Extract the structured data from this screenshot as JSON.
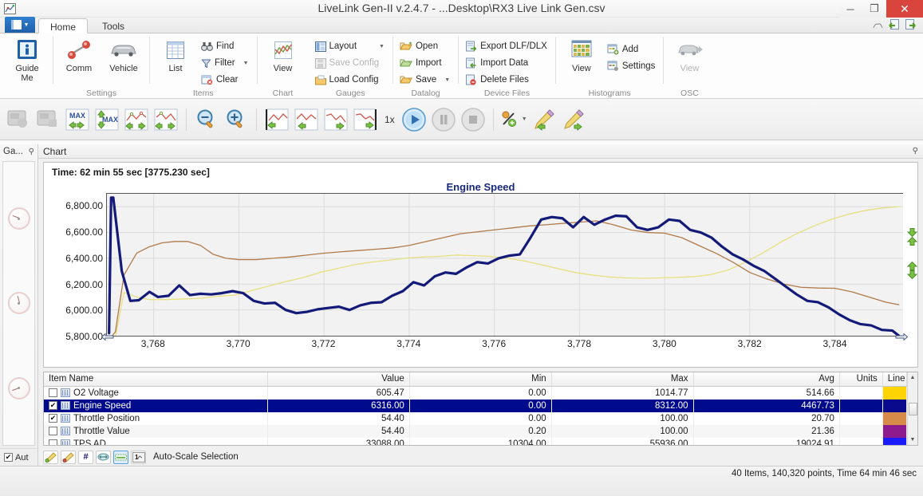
{
  "window": {
    "title": "LiveLink Gen-II  v.2.4.7 - ...Desktop\\RX3 Live Link Gen.csv",
    "app_icon": "chart-app-icon",
    "minimize": "─",
    "maximize": "❐",
    "close": "✕"
  },
  "tabs": {
    "app_menu": "app-menu-button",
    "items": [
      {
        "label": "Home",
        "active": true
      },
      {
        "label": "Tools",
        "active": false
      }
    ],
    "right_icons": [
      "help-cloud-icon",
      "import-page-icon",
      "export-page-icon"
    ]
  },
  "ribbon": {
    "groups": [
      {
        "label": "",
        "big_buttons": [
          {
            "label": "Guide\nMe",
            "icon": "guide-info-icon",
            "disabled": false
          }
        ],
        "small_buttons": []
      },
      {
        "label": "Settings",
        "big_buttons": [
          {
            "label": "Comm",
            "icon": "comm-plug-icon",
            "disabled": false
          },
          {
            "label": "Vehicle",
            "icon": "vehicle-car-icon",
            "disabled": false
          }
        ],
        "small_buttons": []
      },
      {
        "label": "Items",
        "big_buttons": [
          {
            "label": "List",
            "icon": "list-grid-icon",
            "disabled": false
          }
        ],
        "small_buttons": [
          {
            "label": "Find",
            "icon": "find-binoculars-icon",
            "disabled": false,
            "caret": false
          },
          {
            "label": "Filter",
            "icon": "filter-funnel-icon",
            "disabled": false,
            "caret": true
          },
          {
            "label": "Clear",
            "icon": "clear-table-icon",
            "disabled": false,
            "caret": false
          }
        ]
      },
      {
        "label": "Chart",
        "big_buttons": [
          {
            "label": "View",
            "icon": "chart-view-icon",
            "disabled": false
          }
        ],
        "small_buttons": []
      },
      {
        "label": "Gauges",
        "big_buttons": [],
        "small_buttons": [
          {
            "label": "Layout",
            "icon": "layout-icon",
            "disabled": false,
            "caret": true
          },
          {
            "label": "Save Config",
            "icon": "save-config-icon",
            "disabled": true,
            "caret": false
          },
          {
            "label": "Load Config",
            "icon": "load-config-icon",
            "disabled": false,
            "caret": false
          }
        ]
      },
      {
        "label": "Datalog",
        "big_buttons": [],
        "small_buttons": [
          {
            "label": "Open",
            "icon": "open-folder-icon",
            "disabled": false,
            "caret": false
          },
          {
            "label": "Import",
            "icon": "import-icon",
            "disabled": false,
            "caret": false
          },
          {
            "label": "Save",
            "icon": "save-icon",
            "disabled": false,
            "caret": true
          }
        ]
      },
      {
        "label": "Device Files",
        "big_buttons": [],
        "small_buttons": [
          {
            "label": "Export DLF/DLX",
            "icon": "export-file-icon",
            "disabled": false,
            "caret": false
          },
          {
            "label": "Import Data",
            "icon": "import-data-icon",
            "disabled": false,
            "caret": false
          },
          {
            "label": "Delete Files",
            "icon": "delete-file-icon",
            "disabled": false,
            "caret": false
          }
        ]
      },
      {
        "label": "Histograms",
        "big_buttons": [
          {
            "label": "View",
            "icon": "histogram-view-icon",
            "disabled": false
          }
        ],
        "small_buttons": [
          {
            "label": "Add",
            "icon": "add-histogram-icon",
            "disabled": false,
            "caret": false
          },
          {
            "label": "Settings",
            "icon": "histogram-settings-icon",
            "disabled": false,
            "caret": false
          }
        ]
      },
      {
        "label": "OSC",
        "big_buttons": [
          {
            "label": "View",
            "icon": "osc-view-icon",
            "disabled": true
          }
        ],
        "small_buttons": []
      }
    ]
  },
  "toolbar": {
    "speed_label": "1x",
    "buttons": [
      {
        "name": "record-button",
        "icon": "record-disabled-icon",
        "disabled": true
      },
      {
        "name": "stop-record-button",
        "icon": "stop-record-disabled-icon",
        "disabled": true
      },
      {
        "name": "max-prev-button",
        "icon": "max-left-right-icon",
        "disabled": false
      },
      {
        "name": "max-updown-button",
        "icon": "max-up-down-icon",
        "disabled": false
      },
      {
        "name": "trace-prev-button",
        "icon": "trace-left-right-icon",
        "disabled": false
      },
      {
        "name": "trace-next-button",
        "icon": "trace-right-left-icon",
        "disabled": false
      },
      {
        "name": "zoom-out-button",
        "icon": "zoom-out-icon",
        "disabled": false
      },
      {
        "name": "zoom-in-button",
        "icon": "zoom-in-icon",
        "disabled": false
      },
      {
        "name": "marker-start-button",
        "icon": "marker-start-icon",
        "disabled": false
      },
      {
        "name": "marker-left-button",
        "icon": "marker-left-icon",
        "disabled": false
      },
      {
        "name": "marker-right-button",
        "icon": "marker-right-icon",
        "disabled": false
      },
      {
        "name": "marker-end-button",
        "icon": "marker-end-icon",
        "disabled": false
      },
      {
        "name": "play-button",
        "icon": "play-icon",
        "disabled": false
      },
      {
        "name": "pause-button",
        "icon": "pause-icon",
        "disabled": true
      },
      {
        "name": "stop-button",
        "icon": "stop-icon",
        "disabled": true
      },
      {
        "name": "percent-button",
        "icon": "percent-icon",
        "disabled": false,
        "caret": true
      },
      {
        "name": "pencil-left-button",
        "icon": "pencil-left-icon",
        "disabled": false
      },
      {
        "name": "pencil-right-button",
        "icon": "pencil-right-icon",
        "disabled": false
      }
    ]
  },
  "gauges_panel": {
    "title": "Ga...",
    "pin_icon": "pin-icon",
    "auto_checkbox_label": "Aut",
    "auto_checked": true,
    "gauges": [
      "gauge-1",
      "gauge-2",
      "gauge-3"
    ]
  },
  "chart_panel": {
    "header": "Chart",
    "pin_icon": "pin-icon",
    "time_label": "Time: 62 min 55 sec [3775.230 sec]"
  },
  "chart_data": {
    "type": "line",
    "title": "Engine Speed",
    "xlabel": "",
    "ylabel": "",
    "grid": true,
    "legend_position": "none",
    "xlim": [
      3766.9,
      3785.6
    ],
    "ylim": [
      5800,
      6900
    ],
    "yticks": [
      "6,800.00",
      "6,600.00",
      "6,400.00",
      "6,200.00",
      "6,000.00",
      "5,800.00"
    ],
    "ytick_values": [
      6800,
      6600,
      6400,
      6200,
      6000,
      5800
    ],
    "xticks": [
      "3,768",
      "3,770",
      "3,772",
      "3,774",
      "3,776",
      "3,778",
      "3,780",
      "3,782",
      "3,784"
    ],
    "xtick_values": [
      3768,
      3770,
      3772,
      3774,
      3776,
      3778,
      3780,
      3782,
      3784
    ],
    "series": [
      {
        "name": "Engine Speed",
        "color": "#131a78",
        "width": 3.2,
        "x": [
          3766.95,
          3767.0,
          3767.05,
          3767.25,
          3767.45,
          3767.65,
          3767.9,
          3768.1,
          3768.35,
          3768.6,
          3768.85,
          3769.1,
          3769.35,
          3769.6,
          3769.85,
          3770.1,
          3770.35,
          3770.6,
          3770.85,
          3771.1,
          3771.35,
          3771.6,
          3771.85,
          3772.1,
          3772.35,
          3772.6,
          3772.85,
          3773.1,
          3773.35,
          3773.6,
          3773.85,
          3774.1,
          3774.35,
          3774.6,
          3774.85,
          3775.1,
          3775.35,
          3775.6,
          3775.85,
          3776.1,
          3776.35,
          3776.6,
          3776.85,
          3777.1,
          3777.35,
          3777.6,
          3777.85,
          3778.1,
          3778.35,
          3778.6,
          3778.85,
          3779.1,
          3779.35,
          3779.6,
          3779.85,
          3780.1,
          3780.35,
          3780.6,
          3780.85,
          3781.1,
          3781.35,
          3781.6,
          3781.85,
          3782.1,
          3782.35,
          3782.6,
          3782.85,
          3783.1,
          3783.35,
          3783.6,
          3783.85,
          3784.1,
          3784.35,
          3784.6,
          3784.85,
          3785.1,
          3785.35,
          3785.5
        ],
        "y": [
          5820,
          6870,
          6870,
          6300,
          6070,
          6075,
          6140,
          6100,
          6110,
          6190,
          6115,
          6125,
          6120,
          6130,
          6145,
          6130,
          6070,
          6050,
          6055,
          6000,
          5975,
          5985,
          6005,
          6015,
          6025,
          6000,
          6035,
          6055,
          6060,
          6110,
          6145,
          6215,
          6190,
          6260,
          6290,
          6280,
          6330,
          6370,
          6360,
          6400,
          6420,
          6430,
          6560,
          6700,
          6720,
          6710,
          6640,
          6720,
          6660,
          6700,
          6730,
          6725,
          6640,
          6620,
          6640,
          6700,
          6690,
          6620,
          6600,
          6560,
          6490,
          6430,
          6390,
          6340,
          6300,
          6240,
          6180,
          6120,
          6070,
          6060,
          6020,
          5965,
          5920,
          5890,
          5880,
          5845,
          5840,
          5800
        ]
      },
      {
        "name": "Throttle Position",
        "color": "#b07a4a",
        "width": 1.3,
        "x": [
          3766.95,
          3767.1,
          3767.3,
          3767.6,
          3767.9,
          3768.2,
          3768.5,
          3768.8,
          3769.1,
          3769.4,
          3769.7,
          3770.0,
          3770.4,
          3770.8,
          3771.2,
          3771.6,
          3772.0,
          3772.4,
          3772.8,
          3773.2,
          3773.6,
          3774.0,
          3774.4,
          3774.8,
          3775.2,
          3775.6,
          3776.0,
          3776.4,
          3776.8,
          3777.2,
          3777.6,
          3778.0,
          3778.4,
          3778.8,
          3779.2,
          3779.6,
          3780.0,
          3780.4,
          3780.8,
          3781.2,
          3781.6,
          3782.0,
          3782.4,
          3782.8,
          3783.2,
          3783.6,
          3784.0,
          3784.4,
          3784.8,
          3785.2,
          3785.5
        ],
        "y": [
          5770,
          5830,
          6270,
          6440,
          6490,
          6520,
          6530,
          6530,
          6500,
          6430,
          6400,
          6390,
          6390,
          6400,
          6410,
          6425,
          6440,
          6450,
          6460,
          6470,
          6480,
          6500,
          6530,
          6560,
          6590,
          6605,
          6620,
          6635,
          6650,
          6660,
          6670,
          6680,
          6690,
          6660,
          6620,
          6600,
          6595,
          6560,
          6500,
          6440,
          6370,
          6290,
          6240,
          6200,
          6175,
          6170,
          6168,
          6140,
          6100,
          6060,
          6040
        ]
      },
      {
        "name": "Throttle Value",
        "color": "#e8e080",
        "width": 1.3,
        "x": [
          3766.95,
          3767.1,
          3767.3,
          3767.6,
          3767.9,
          3768.3,
          3768.7,
          3769.1,
          3769.5,
          3769.9,
          3770.3,
          3770.7,
          3771.1,
          3771.5,
          3771.9,
          3772.3,
          3772.7,
          3773.1,
          3773.5,
          3773.9,
          3774.3,
          3774.7,
          3775.1,
          3775.5,
          3775.9,
          3776.3,
          3776.7,
          3777.1,
          3777.5,
          3777.9,
          3778.3,
          3778.7,
          3779.1,
          3779.5,
          3779.9,
          3780.3,
          3780.7,
          3781.1,
          3781.5,
          3781.9,
          3782.3,
          3782.7,
          3783.1,
          3783.5,
          3783.9,
          3784.3,
          3784.7,
          3785.1,
          3785.5
        ],
        "y": [
          5790,
          5790,
          6135,
          6100,
          6080,
          6080,
          6085,
          6090,
          6105,
          6115,
          6150,
          6185,
          6220,
          6250,
          6290,
          6320,
          6350,
          6370,
          6385,
          6400,
          6410,
          6415,
          6425,
          6420,
          6415,
          6400,
          6380,
          6350,
          6320,
          6290,
          6270,
          6255,
          6248,
          6245,
          6248,
          6252,
          6258,
          6275,
          6310,
          6370,
          6440,
          6520,
          6590,
          6650,
          6700,
          6740,
          6770,
          6790,
          6800
        ]
      }
    ]
  },
  "table": {
    "columns": [
      {
        "label": "Item Name",
        "align": "left"
      },
      {
        "label": "Value",
        "align": "right"
      },
      {
        "label": "Min",
        "align": "right"
      },
      {
        "label": "Max",
        "align": "right"
      },
      {
        "label": "Avg",
        "align": "right"
      },
      {
        "label": "Units",
        "align": "right"
      },
      {
        "label": "Line",
        "align": "right"
      }
    ],
    "rows": [
      {
        "checked": false,
        "name": "O2 Voltage",
        "value": "605.47",
        "min": "0.00",
        "max": "1014.77",
        "avg": "514.66",
        "units": "",
        "line_color": "#ffd400",
        "selected": false
      },
      {
        "checked": true,
        "name": "Engine Speed",
        "value": "6316.00",
        "min": "0.00",
        "max": "8312.00",
        "avg": "4467.73",
        "units": "",
        "line_color": "#0a0a8c",
        "selected": true
      },
      {
        "checked": true,
        "name": "Throttle Position",
        "value": "54.40",
        "min": "0.00",
        "max": "100.00",
        "avg": "20.70",
        "units": "",
        "line_color": "#d68b4a",
        "selected": false
      },
      {
        "checked": false,
        "name": "Throttle Value",
        "value": "54.40",
        "min": "0.20",
        "max": "100.00",
        "avg": "21.36",
        "units": "",
        "line_color": "#8e1b8e",
        "selected": false
      },
      {
        "checked": false,
        "name": "TPS AD",
        "value": "33088.00",
        "min": "10304.00",
        "max": "55936.00",
        "avg": "19024.91",
        "units": "",
        "line_color": "#1a1aff",
        "selected": false
      }
    ]
  },
  "bottom_toolbar": {
    "label": "Auto-Scale Selection",
    "buttons": [
      {
        "name": "scale-up-tool",
        "icon": "pencil-green-icon",
        "active": false
      },
      {
        "name": "scale-down-tool",
        "icon": "pencil-red-icon",
        "active": false
      },
      {
        "name": "hash-tool",
        "icon": "hash-icon",
        "active": false
      },
      {
        "name": "fit-width-tool",
        "icon": "fit-width-icon",
        "active": false
      },
      {
        "name": "autoscale-tool",
        "icon": "autoscale-icon",
        "active": true
      },
      {
        "name": "selection-tool",
        "icon": "selection-icon",
        "active": false
      }
    ]
  },
  "status_bar": {
    "info": "40 Items, 140,320 points, Time 64 min 46 sec"
  }
}
